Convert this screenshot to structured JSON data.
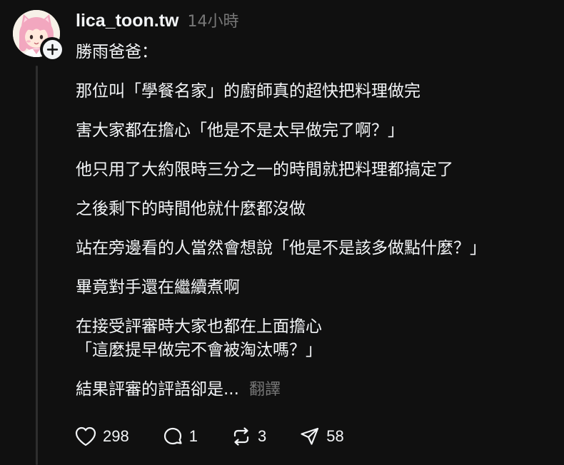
{
  "post": {
    "username": "lica_toon.tw",
    "time_ago": "14小時",
    "paragraphs": [
      "勝雨爸爸：",
      "那位叫「學餐名家」的廚師真的超快把料理做完",
      "害大家都在擔心「他是不是太早做完了啊？」",
      "他只用了大約限時三分之一的時間就把料理都搞定了",
      "之後剩下的時間他就什麼都沒做",
      "站在旁邊看的人當然會想說「他是不是該多做點什麼？」",
      "畢竟對手還在繼續煮啊",
      "在接受評審時大家也都在上面擔心\n「這麼提早做完不會被淘汰嗎？」"
    ],
    "truncated_line": "結果評審的評語卻是...",
    "translate_label": "翻譯"
  },
  "actions": {
    "likes": "298",
    "replies": "1",
    "reposts": "3",
    "shares": "58"
  },
  "colors": {
    "background": "#101010",
    "text": "#f3f5f7",
    "muted": "#777777",
    "avatar_hair": "#f2a7bf"
  }
}
